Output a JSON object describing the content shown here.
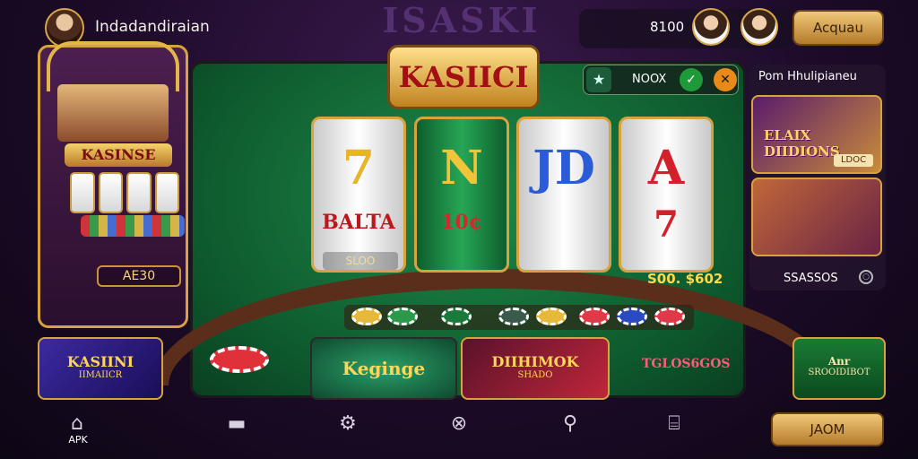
{
  "background_sign": "ISASKI",
  "header": {
    "username": "Indadandiraian",
    "balance": "8100",
    "account_button": "Acquau"
  },
  "cabinet": {
    "title": "KASINSE",
    "value": "AE30"
  },
  "game": {
    "logo": "KASIICI",
    "mode_label": "NOOX",
    "reels": [
      {
        "top": "7",
        "mid": "BALTA",
        "bottom": "SLOO",
        "color": "#e7b52a"
      },
      {
        "top": "N",
        "mid": "10¢",
        "bottom": "",
        "color": "#f2c43a"
      },
      {
        "top": "JD",
        "mid": "",
        "bottom": "",
        "color": "#2c5bd8"
      },
      {
        "top": "A",
        "mid": "7",
        "bottom": "",
        "color": "#d4202a"
      }
    ],
    "win_label": "S00. $602"
  },
  "right_panel": {
    "title": "Pom Hhulipianeu",
    "card1_label": "ELAIX DIIDIONS",
    "card1_badge": "LDOC",
    "footer": "SSASSOS"
  },
  "banners": {
    "b1_title": "KASIINI",
    "b1_sub": "IIMAIICR",
    "b2_title": "Keginge",
    "b3_title": "DIIHIMOK",
    "b3_sub": "SHADO",
    "promo_text": "TGLOS6GOS",
    "b5_title": "Anr",
    "b5_sub": "SROOIDIBOT"
  },
  "nav": {
    "apk_label": "APK",
    "join_button": "JAOM"
  },
  "colors": {
    "accent_gold": "#d6a33f",
    "felt_green": "#1f8a49",
    "bg_purple": "#3b1a4e"
  }
}
